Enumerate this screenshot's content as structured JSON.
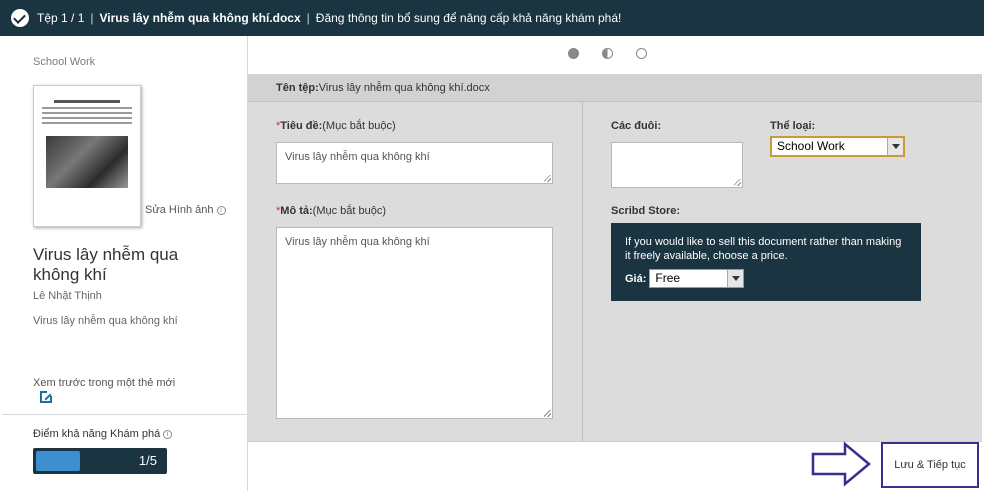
{
  "topbar": {
    "step": "Tệp 1 / 1",
    "file_name": "Virus lây nhễm qua không khí.docx",
    "message": "Đăng thông tin bổ sung để nâng cấp khả năng khám phá!"
  },
  "left": {
    "category": "School Work",
    "edit_image": "Sửa Hình ảnh",
    "doc_title": "Virus lây nhễm qua không khí",
    "author": "Lê Nhật Thịnh",
    "description": "Virus lây nhễm qua không khí",
    "preview_link": "Xem trước trong một thẻ mới",
    "score_label": "Điểm khả năng Khám phá",
    "score_text": "1/5",
    "score_value": 1,
    "score_max": 5
  },
  "steps": {
    "total": 3,
    "states": [
      "filled",
      "half",
      "empty"
    ]
  },
  "file_bar": {
    "label": "Tên tệp:",
    "value": "Virus lây nhễm qua không khí.docx"
  },
  "form": {
    "title_label": "Tiêu đề:",
    "title_hint": "(Mục bắt buộc)",
    "title_value": "Virus lây nhễm qua không khí",
    "desc_label": "Mô tả:",
    "desc_hint": "(Mục bắt buộc)",
    "desc_value": "Virus lây nhễm qua không khí",
    "tags_label": "Các đuôi:",
    "tags_value": "",
    "category_label": "Thể loại:",
    "category_value": "School Work",
    "store_label": "Scribd Store:",
    "store_text": "If you would like to sell this document rather than making it freely available, choose a price.",
    "price_label": "Giá:",
    "price_value": "Free"
  },
  "footer": {
    "save_label": "Lưu & Tiếp tục"
  },
  "colors": {
    "topbar": "#1a3441",
    "accent": "#3d8fd0",
    "required": "#c0392b",
    "highlight_outline": "#3b2f8a"
  }
}
